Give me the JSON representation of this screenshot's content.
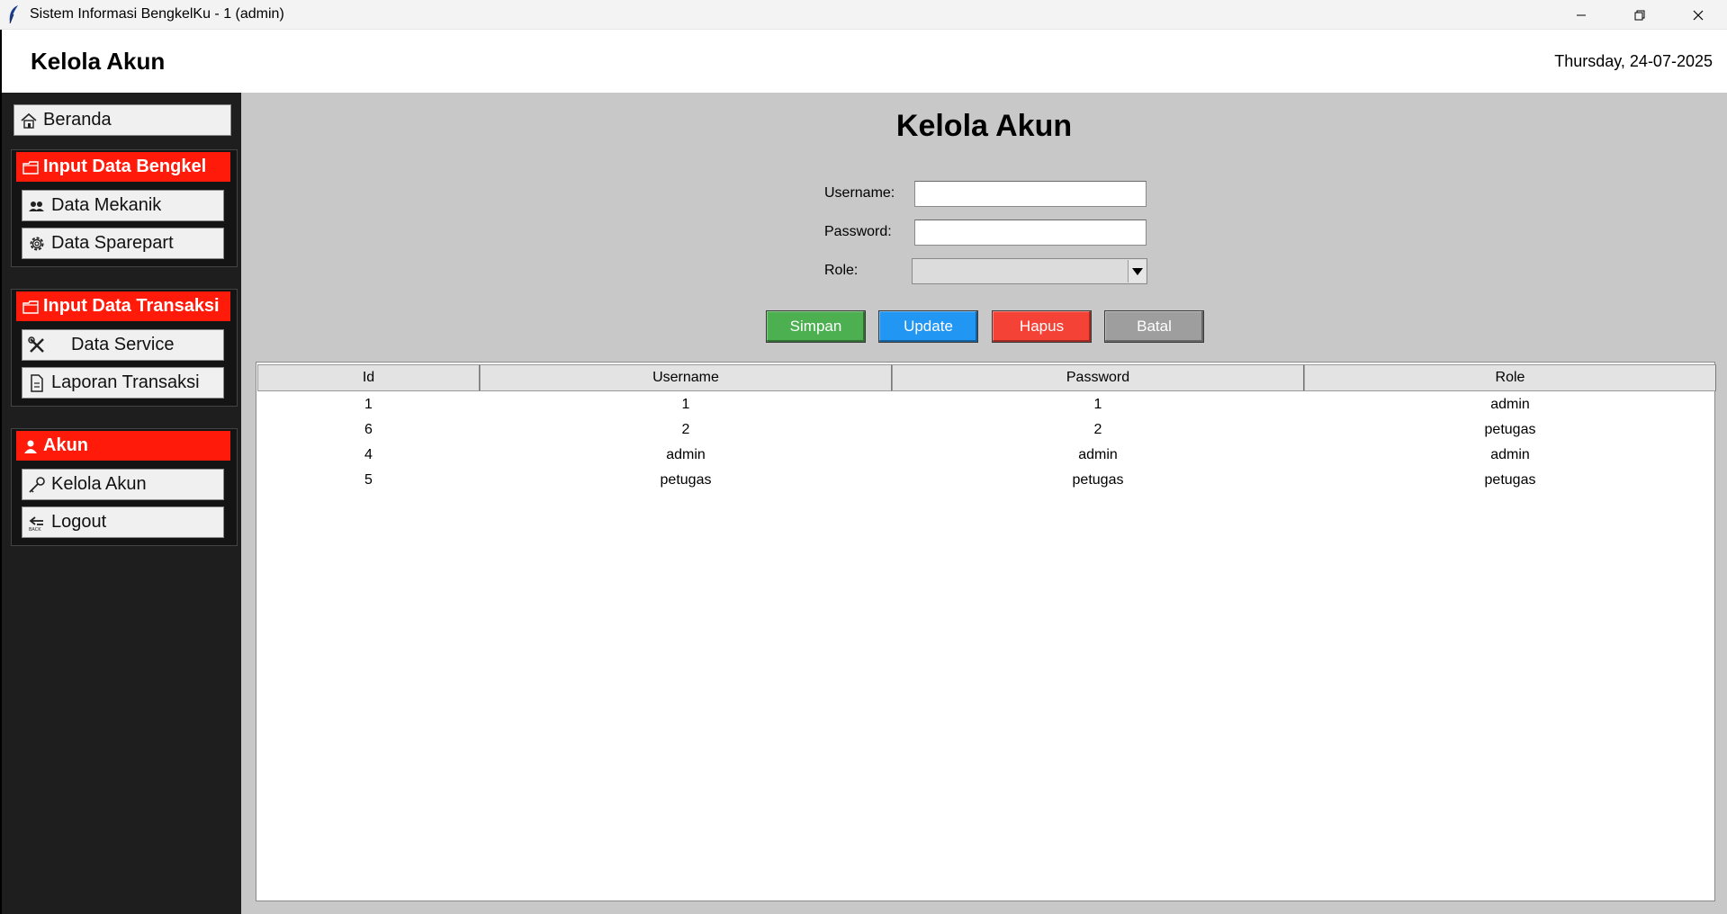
{
  "window": {
    "title": "Sistem Informasi BengkelKu - 1 (admin)"
  },
  "header": {
    "title": "Kelola Akun",
    "date": "Thursday, 24-07-2025"
  },
  "sidebar": {
    "beranda": {
      "label": "Beranda",
      "icon": "home-icon"
    },
    "groups": [
      {
        "header": "Input Data Bengkel",
        "icon": "folder-icon",
        "items": [
          {
            "label": "Data Mekanik",
            "icon": "users-icon"
          },
          {
            "label": "Data Sparepart",
            "icon": "gear-icon"
          }
        ]
      },
      {
        "header": "Input Data Transaksi",
        "icon": "folder-icon",
        "items": [
          {
            "label": "Data Service",
            "icon": "tools-icon"
          },
          {
            "label": "Laporan Transaksi",
            "icon": "document-icon"
          }
        ]
      },
      {
        "header": "Akun",
        "icon": "user-icon",
        "items": [
          {
            "label": "Kelola Akun",
            "icon": "key-icon"
          },
          {
            "label": "Logout",
            "icon": "back-icon"
          }
        ]
      }
    ]
  },
  "main": {
    "title": "Kelola Akun",
    "form": {
      "username_label": "Username:",
      "username_value": "",
      "password_label": "Password:",
      "password_value": "",
      "role_label": "Role:",
      "role_value": ""
    },
    "buttons": {
      "simpan": {
        "label": "Simpan",
        "color": "#4caf50"
      },
      "update": {
        "label": "Update",
        "color": "#2196f3"
      },
      "hapus": {
        "label": "Hapus",
        "color": "#f44336"
      },
      "batal": {
        "label": "Batal",
        "color": "#9e9e9e"
      }
    },
    "table": {
      "columns": [
        "Id",
        "Username",
        "Password",
        "Role"
      ],
      "rows": [
        [
          "1",
          "1",
          "1",
          "admin"
        ],
        [
          "6",
          "2",
          "2",
          "petugas"
        ],
        [
          "4",
          "admin",
          "admin",
          "admin"
        ],
        [
          "5",
          "petugas",
          "petugas",
          "petugas"
        ]
      ]
    }
  },
  "colors": {
    "sidebar_bg": "#1e1e1e",
    "group_header": "#ff1a0a",
    "main_bg": "#c8c8c8"
  }
}
